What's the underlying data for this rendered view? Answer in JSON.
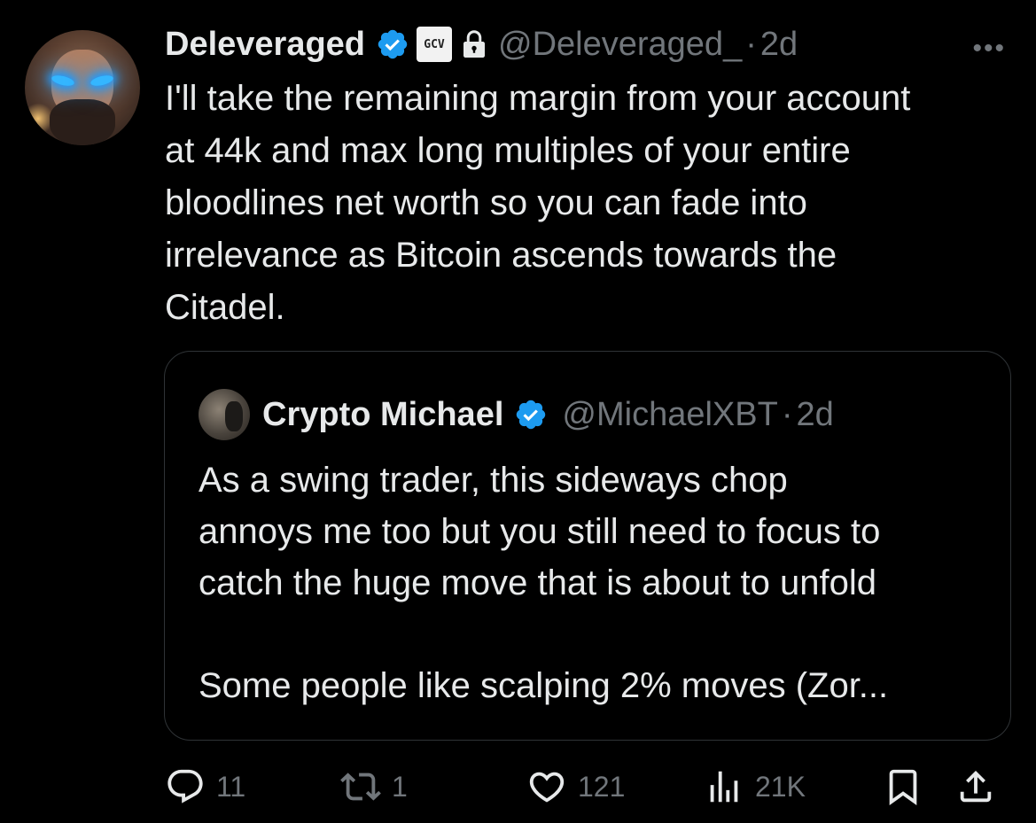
{
  "tweet": {
    "author_name": "Deleveraged",
    "author_handle": "@Deleveraged_",
    "time": "2d",
    "badge_text": "GCV",
    "text_lines": [
      "I'll take the remaining margin from your account",
      "at 44k and max long multiples of your entire",
      "bloodlines net worth so you can fade into",
      "irrelevance as Bitcoin ascends towards the",
      "Citadel."
    ],
    "more_label": "•••"
  },
  "quote": {
    "author_name": "Crypto Michael",
    "author_handle": "@MichaelXBT",
    "time": "2d",
    "text_lines": [
      "As a swing trader, this sideways chop",
      "annoys me too but you still need to focus to",
      "catch the huge move that is about to unfold"
    ],
    "text_truncated": "Some people like scalping 2% moves (Zor..."
  },
  "actions": {
    "replies": "11",
    "reposts": "1",
    "likes": "121",
    "views": "21K"
  },
  "colors": {
    "background": "#000000",
    "text": "#e7e9ea",
    "muted": "#71767b",
    "verified_blue": "#1d9bf0",
    "border": "#2f3336"
  },
  "icons": {
    "verified": "verified-badge-icon",
    "lock": "lock-icon",
    "reply": "reply-icon",
    "repost": "repost-icon",
    "like": "heart-icon",
    "views": "analytics-icon",
    "bookmark": "bookmark-icon",
    "share": "share-icon"
  }
}
